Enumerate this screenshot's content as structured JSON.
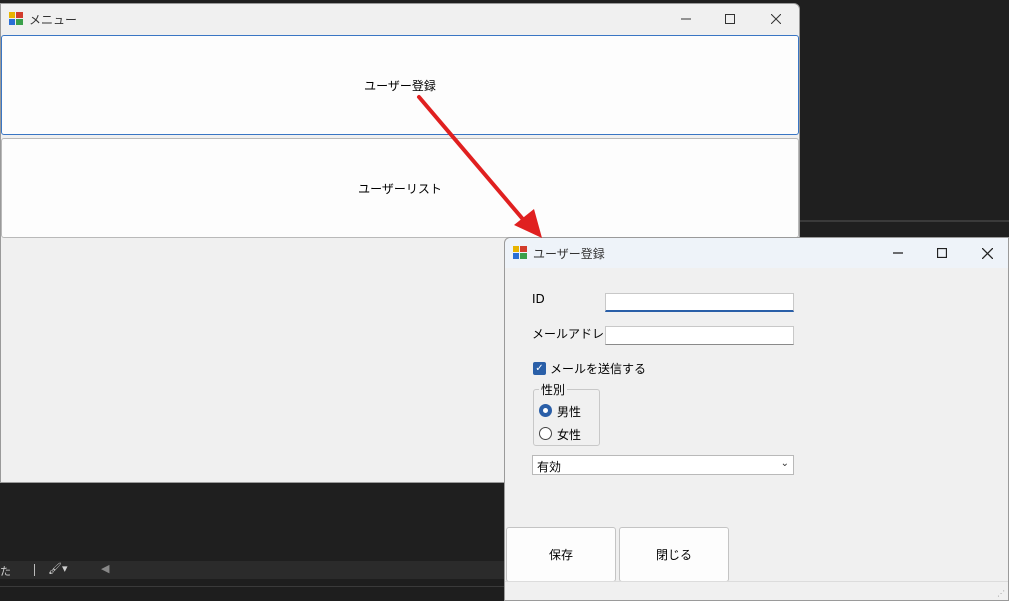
{
  "ide": {
    "status_text": "た"
  },
  "menu_window": {
    "title": "メニュー",
    "buttons": {
      "register": "ユーザー登録",
      "list": "ユーザーリスト"
    }
  },
  "register_window": {
    "title": "ユーザー登録",
    "fields": {
      "id_label": "ID",
      "id_value": "",
      "email_label": "メールアドレス",
      "email_value": ""
    },
    "send_mail_checkbox": {
      "label": "メールを送信する",
      "checked": true
    },
    "gender_group": {
      "title": "性別",
      "options": [
        "男性",
        "女性"
      ],
      "selected": "男性"
    },
    "status_combo": {
      "selected": "有効"
    },
    "buttons": {
      "save": "保存",
      "close": "閉じる"
    }
  },
  "colors": {
    "accent": "#2a5fa8",
    "arrow": "#e02020",
    "ide_background": "#1f1f1f"
  }
}
